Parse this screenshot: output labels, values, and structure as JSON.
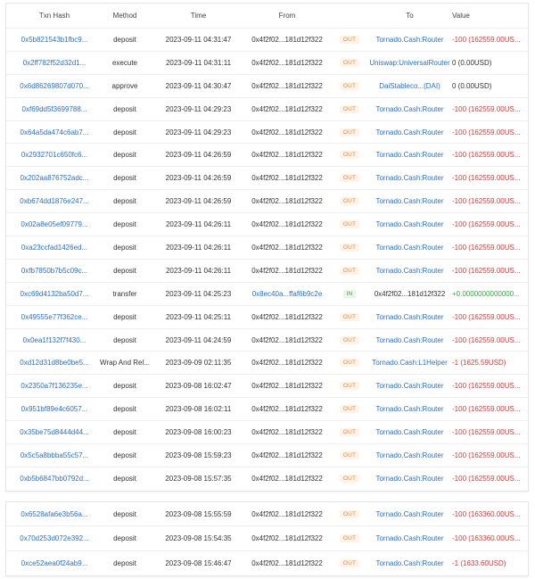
{
  "table": {
    "headers": {
      "hash": "Txn Hash",
      "method": "Method",
      "time": "Time",
      "from": "From",
      "to": "To",
      "value": "Value"
    },
    "rows": [
      {
        "hash": "0x5b821543b1fbc9...",
        "method": "deposit",
        "time": "2023-09-11 04:31:47",
        "from": "0x4f2f02...181d12f322",
        "dir": "OUT",
        "to": "Tornado.Cash:Router",
        "value": "-100  (162559.00US..."
      },
      {
        "hash": "0x2ff782f52d32d1...",
        "method": "execute",
        "time": "2023-09-11 04:31:11",
        "from": "0x4f2f02...181d12f322",
        "dir": "OUT",
        "to": "Uniswap:UniversalRouter",
        "value": "0  (0.00USD)"
      },
      {
        "hash": "0x6d86269807d070...",
        "method": "approve",
        "time": "2023-09-11 04:30:47",
        "from": "0x4f2f02...181d12f322",
        "dir": "OUT",
        "to": "DaiStableco...(DAI)",
        "value": "0  (0.00USD)"
      },
      {
        "hash": "0xf69dd5f3699788...",
        "method": "deposit",
        "time": "2023-09-11 04:29:23",
        "from": "0x4f2f02...181d12f322",
        "dir": "OUT",
        "to": "Tornado.Cash:Router",
        "value": "-100  (162559.00US..."
      },
      {
        "hash": "0x64a5da474c6ab7...",
        "method": "deposit",
        "time": "2023-09-11 04:29:23",
        "from": "0x4f2f02...181d12f322",
        "dir": "OUT",
        "to": "Tornado.Cash:Router",
        "value": "-100  (162559.00US..."
      },
      {
        "hash": "0x2932701c650fc6...",
        "method": "deposit",
        "time": "2023-09-11 04:26:59",
        "from": "0x4f2f02...181d12f322",
        "dir": "OUT",
        "to": "Tornado.Cash:Router",
        "value": "-100  (162559.00US..."
      },
      {
        "hash": "0x202aa876752adc...",
        "method": "deposit",
        "time": "2023-09-11 04:26:59",
        "from": "0x4f2f02...181d12f322",
        "dir": "OUT",
        "to": "Tornado.Cash:Router",
        "value": "-100  (162559.00US..."
      },
      {
        "hash": "0xb674dd1876e247...",
        "method": "deposit",
        "time": "2023-09-11 04:26:59",
        "from": "0x4f2f02...181d12f322",
        "dir": "OUT",
        "to": "Tornado.Cash:Router",
        "value": "-100  (162559.00US..."
      },
      {
        "hash": "0x02a8e05ef09779...",
        "method": "deposit",
        "time": "2023-09-11 04:26:11",
        "from": "0x4f2f02...181d12f322",
        "dir": "OUT",
        "to": "Tornado.Cash:Router",
        "value": "-100  (162559.00US..."
      },
      {
        "hash": "0xa23ccfad1426ed...",
        "method": "deposit",
        "time": "2023-09-11 04:26:11",
        "from": "0x4f2f02...181d12f322",
        "dir": "OUT",
        "to": "Tornado.Cash:Router",
        "value": "-100  (162559.00US..."
      },
      {
        "hash": "0xfb7850b7b5c09c...",
        "method": "deposit",
        "time": "2023-09-11 04:26:11",
        "from": "0x4f2f02...181d12f322",
        "dir": "OUT",
        "to": "Tornado.Cash:Router",
        "value": "-100  (162559.00US..."
      },
      {
        "hash": "0xc69d4132ba50d7...",
        "method": "transfer",
        "time": "2023-09-11 04:25:23",
        "from": "0x8ec40a...ffaf6b9c2e",
        "dir": "IN",
        "to": "0x4f2f02...181d12f322",
        "value": "+0.0000000000000..."
      },
      {
        "hash": "0x49555e77f362ce...",
        "method": "deposit",
        "time": "2023-09-11 04:25:11",
        "from": "0x4f2f02...181d12f322",
        "dir": "OUT",
        "to": "Tornado.Cash:Router",
        "value": "-100  (162559.00US..."
      },
      {
        "hash": "0x0ea1f132f7f430...",
        "method": "deposit",
        "time": "2023-09-11 04:24:59",
        "from": "0x4f2f02...181d12f322",
        "dir": "OUT",
        "to": "Tornado.Cash:Router",
        "value": "-100  (162559.00US..."
      },
      {
        "hash": "0xd12d31d8be0be5...",
        "method": "Wrap And Rel...",
        "time": "2023-09-09 02:11:35",
        "from": "0x4f2f02...181d12f322",
        "dir": "OUT",
        "to": "Tornado.Cash:L1Helper",
        "value": "-1  (1625.59USD)"
      },
      {
        "hash": "0x2350a7f136235e...",
        "method": "deposit",
        "time": "2023-09-08 16:02:47",
        "from": "0x4f2f02...181d12f322",
        "dir": "OUT",
        "to": "Tornado.Cash:Router",
        "value": "-100  (162559.00US..."
      },
      {
        "hash": "0x951bf89e4c6057...",
        "method": "deposit",
        "time": "2023-09-08 16:02:11",
        "from": "0x4f2f02...181d12f322",
        "dir": "OUT",
        "to": "Tornado.Cash:Router",
        "value": "-100  (162559.00US..."
      },
      {
        "hash": "0x35be75d8444d44...",
        "method": "deposit",
        "time": "2023-09-08 16:00:23",
        "from": "0x4f2f02...181d12f322",
        "dir": "OUT",
        "to": "Tornado.Cash:Router",
        "value": "-100  (162559.00US..."
      },
      {
        "hash": "0x5c5a8bbba55c57...",
        "method": "deposit",
        "time": "2023-09-08 15:59:23",
        "from": "0x4f2f02...181d12f322",
        "dir": "OUT",
        "to": "Tornado.Cash:Router",
        "value": "-100  (162559.00US..."
      },
      {
        "hash": "0xb5b6847bb0792d...",
        "method": "deposit",
        "time": "2023-09-08 15:57:35",
        "from": "0x4f2f02...181d12f322",
        "dir": "OUT",
        "to": "Tornado.Cash:Router",
        "value": "-100  (162559.00US..."
      }
    ],
    "rows2": [
      {
        "hash": "0x6528afa6e3b56a...",
        "method": "deposit",
        "time": "2023-09-08 15:55:59",
        "from": "0x4f2f02...181d12f322",
        "dir": "OUT",
        "to": "Tornado.Cash:Router",
        "value": "-100  (163360.00US..."
      },
      {
        "hash": "0x70d253d072e392...",
        "method": "deposit",
        "time": "2023-09-08 15:54:35",
        "from": "0x4f2f02...181d12f322",
        "dir": "OUT",
        "to": "Tornado.Cash:Router",
        "value": "-100  (163360.00US..."
      },
      {
        "hash": "0xce52aea0f24ab9...",
        "method": "deposit",
        "time": "2023-09-08 15:46:47",
        "from": "0x4f2f02...181d12f322",
        "dir": "OUT",
        "to": "Tornado.Cash:Router",
        "value": "-1  (1633.60USD)"
      }
    ]
  }
}
